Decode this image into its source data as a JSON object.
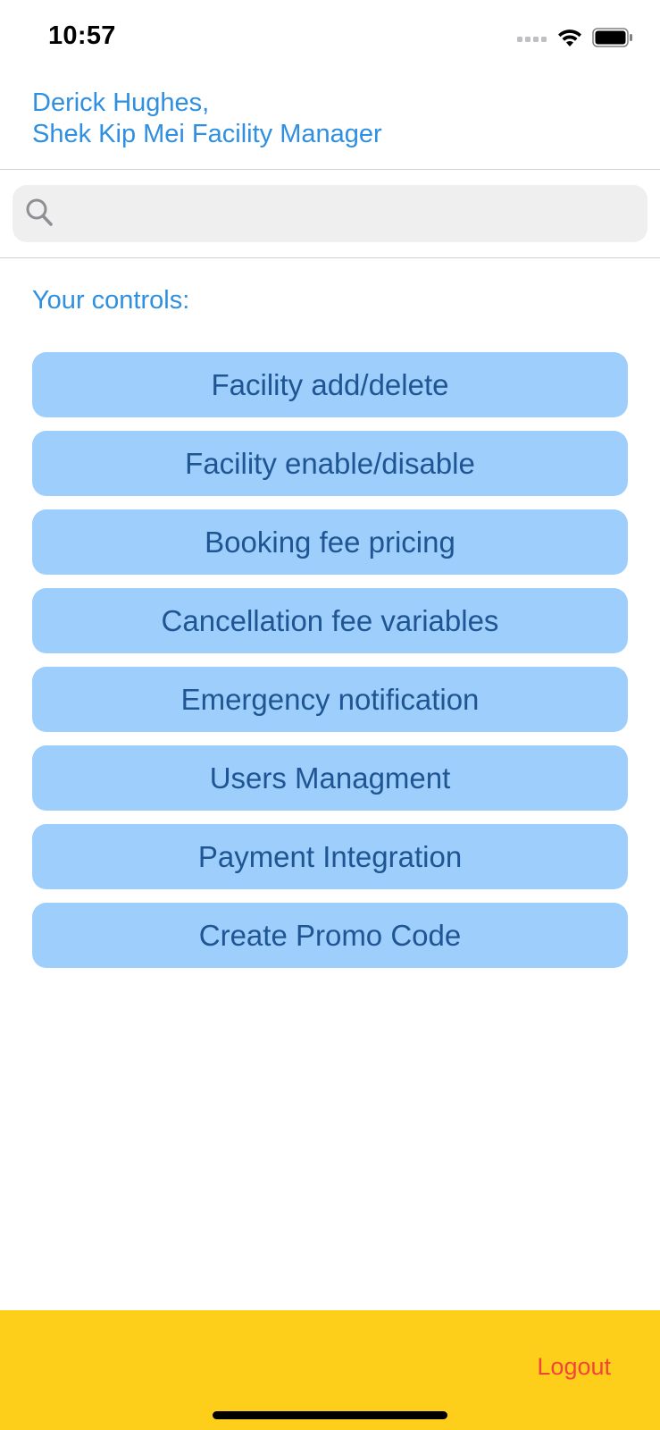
{
  "status_bar": {
    "time": "10:57",
    "icons": [
      "signal-icon",
      "wifi-icon",
      "battery-icon"
    ]
  },
  "header": {
    "user_name": "Derick Hughes,",
    "user_role": "Shek Kip Mei Facility Manager"
  },
  "search": {
    "placeholder": ""
  },
  "controls": {
    "label": "Your controls:",
    "buttons": [
      "Facility add/delete",
      "Facility enable/disable",
      "Booking fee pricing",
      "Cancellation fee variables",
      "Emergency notification",
      "Users Managment",
      "Payment Integration",
      "Create Promo Code"
    ]
  },
  "footer": {
    "logout_label": "Logout"
  },
  "colors": {
    "accent": "#2f8fe0",
    "button_bg": "#9dcefc",
    "button_text": "#1f5592",
    "footer_bg": "#fdcf1b",
    "logout": "#f2453a"
  }
}
